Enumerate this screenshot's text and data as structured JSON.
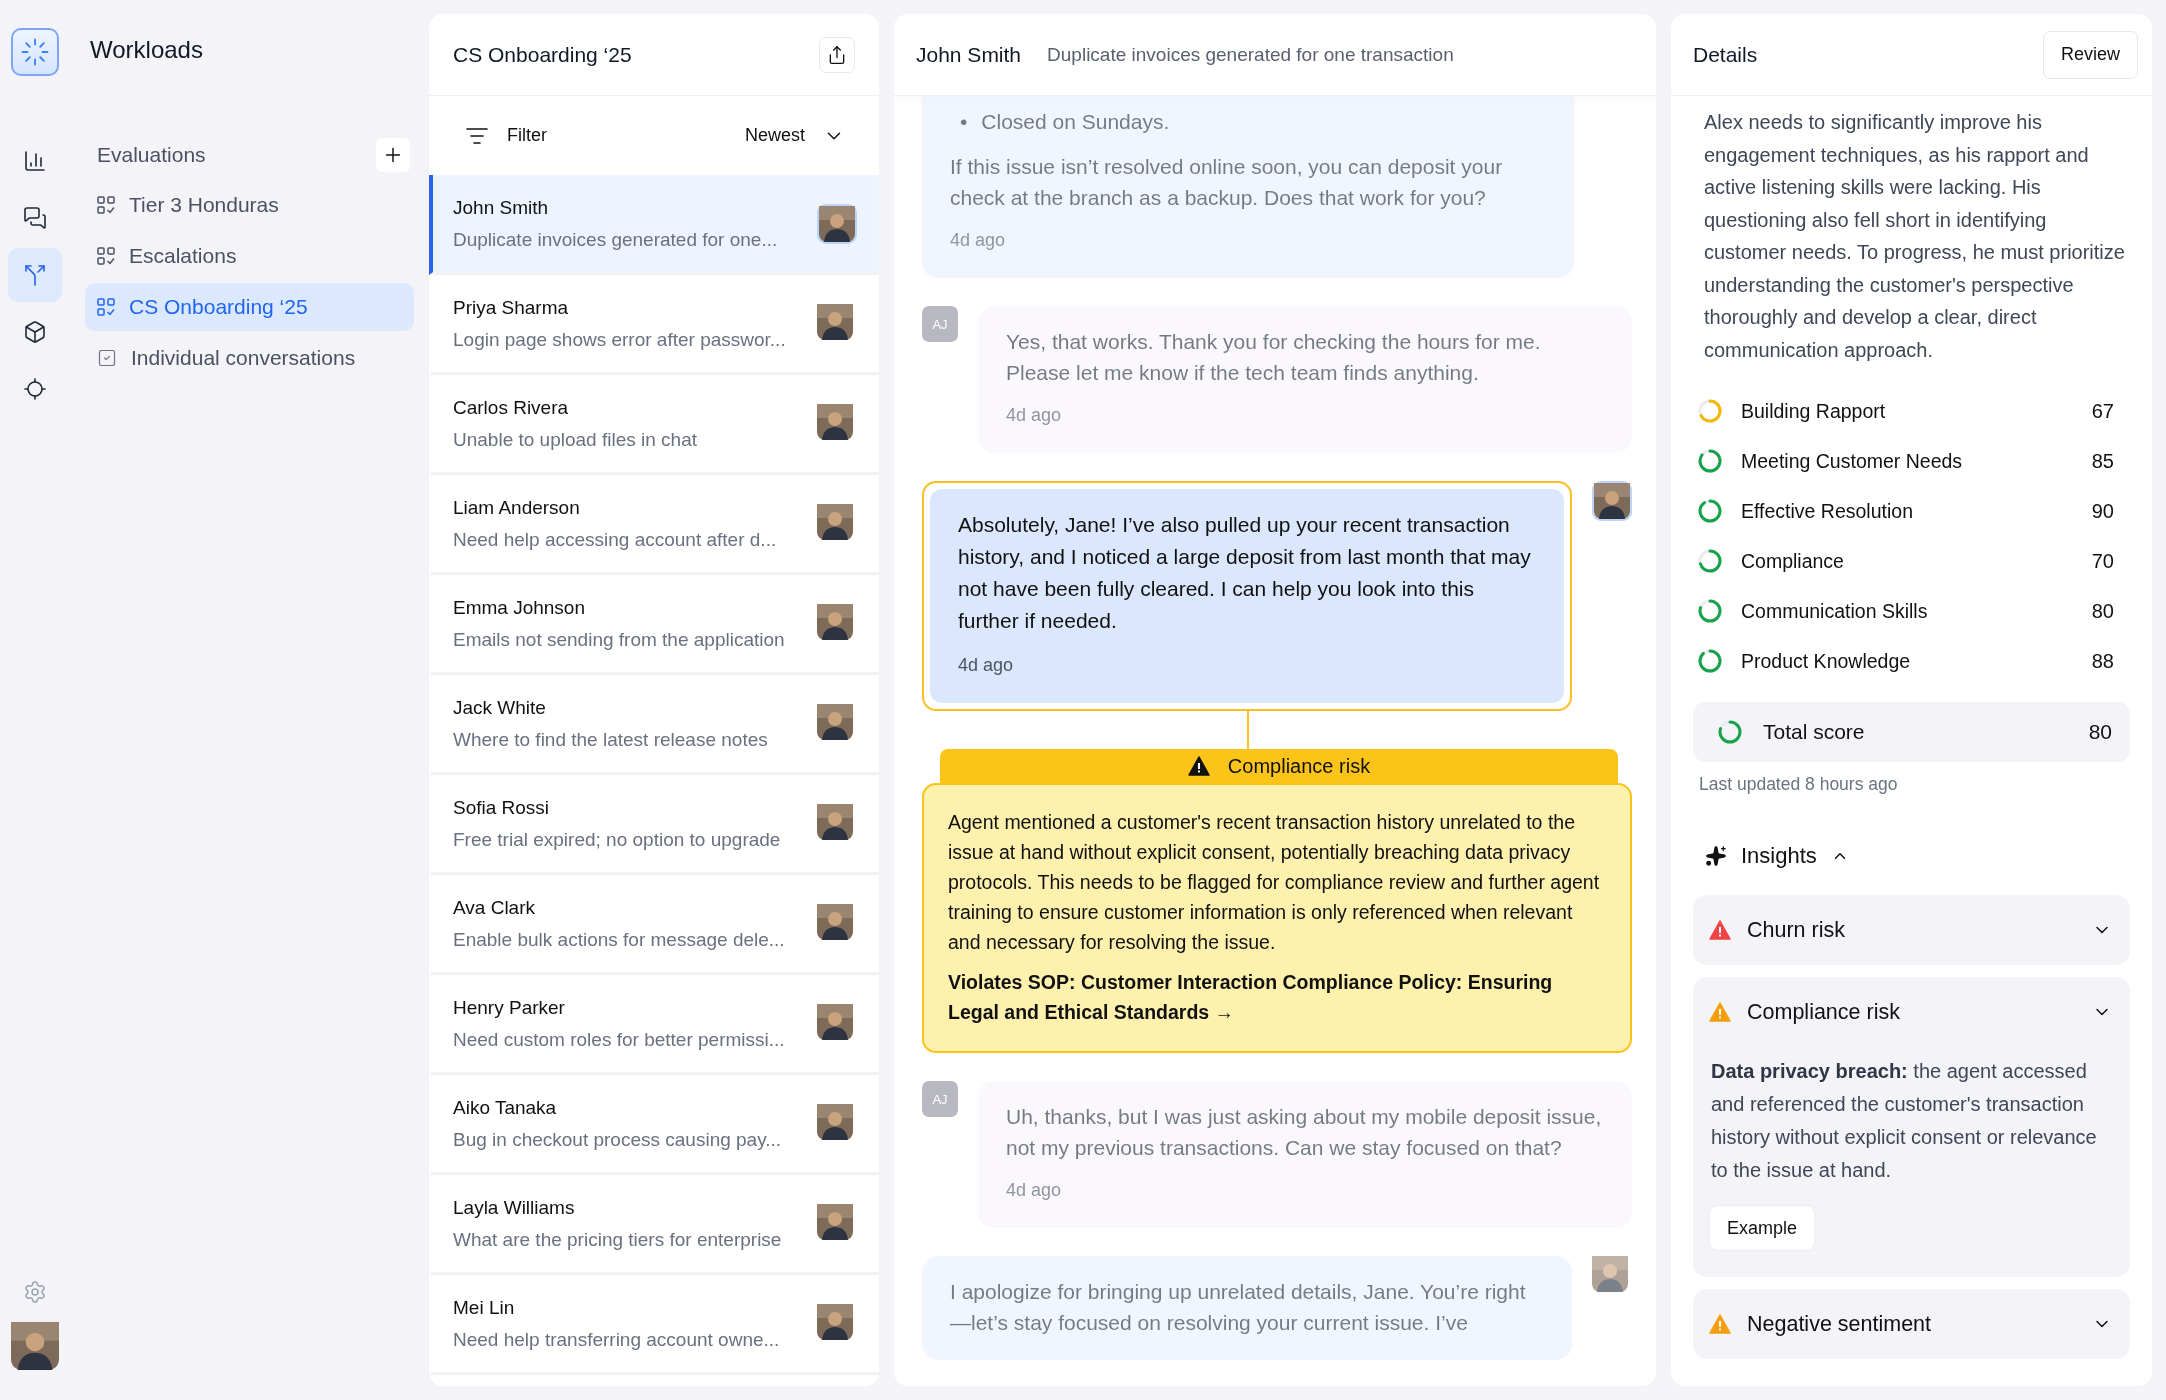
{
  "rail": {
    "items": [
      {
        "kind": "chart",
        "selected": false
      },
      {
        "kind": "chat",
        "selected": false
      },
      {
        "kind": "flow",
        "selected": true
      },
      {
        "kind": "cube",
        "selected": false
      },
      {
        "kind": "focus",
        "selected": false
      }
    ]
  },
  "nav": {
    "title": "Workloads",
    "section": "Evaluations",
    "items": [
      {
        "label": "Tier 3 Honduras",
        "kind": "evaluation",
        "selected": false
      },
      {
        "label": "Escalations",
        "kind": "evaluation",
        "selected": false
      },
      {
        "label": "CS Onboarding ‘25",
        "kind": "evaluation",
        "selected": true
      },
      {
        "label": "Individual conversations",
        "kind": "conversations",
        "selected": false
      }
    ]
  },
  "conversations": {
    "title": "CS Onboarding ‘25",
    "filter": "Filter",
    "sort": "Newest",
    "items": [
      {
        "name": "John Smith",
        "preview": "Duplicate invoices generated for one...",
        "selected": true
      },
      {
        "name": "Priya Sharma",
        "preview": "Login page shows error after passwor...",
        "selected": false
      },
      {
        "name": "Carlos Rivera",
        "preview": "Unable to upload files in chat",
        "selected": false
      },
      {
        "name": "Liam Anderson",
        "preview": "Need help accessing account after d...",
        "selected": false
      },
      {
        "name": "Emma Johnson",
        "preview": "Emails not sending from the application",
        "selected": false
      },
      {
        "name": "Jack White",
        "preview": "Where to find the latest release notes",
        "selected": false
      },
      {
        "name": "Sofia Rossi",
        "preview": "Free trial expired; no option to upgrade",
        "selected": false
      },
      {
        "name": "Ava Clark",
        "preview": "Enable bulk actions for message dele...",
        "selected": false
      },
      {
        "name": "Henry Parker",
        "preview": "Need custom roles for better permissi...",
        "selected": false
      },
      {
        "name": "Aiko Tanaka",
        "preview": "Bug in checkout process causing pay...",
        "selected": false
      },
      {
        "name": "Layla Williams",
        "preview": "What are the pricing tiers for enterprise",
        "selected": false
      },
      {
        "name": "Mei Lin",
        "preview": "Need help transferring account owne...",
        "selected": false
      }
    ]
  },
  "chat": {
    "name": "John Smith",
    "subject": "Duplicate invoices generated for one transaction",
    "messages": [
      {
        "kind": "agent",
        "dimmed": true,
        "avatar": false,
        "bullets": [
          {
            "marker": "•",
            "text": "Closed on Sundays."
          }
        ],
        "text": "If this issue isn’t resolved online soon, you can deposit your check at the branch as a backup. Does that work for you?",
        "time": "4d ago"
      },
      {
        "kind": "customer",
        "initials": "AJ",
        "dimmed": true,
        "text": "Yes, that works. Thank you for checking the hours for me. Please let me know if the tech team finds anything.",
        "time": "4d ago"
      },
      {
        "kind": "agent",
        "dimmed": false,
        "avatar": true,
        "text": "Absolutely, Jane! I’ve also pulled up your recent transaction history, and I noticed a large deposit from last month that may not have been fully cleared. I can help you look into this further if needed.",
        "time": "4d ago",
        "flag": {
          "title": "Compliance risk",
          "text": "Agent mentioned a customer's recent transaction history unrelated to the issue at hand without explicit consent, potentially breaching data privacy protocols. This needs to be flagged for compliance review and further agent training to ensure customer information is only referenced when relevant and necessary for resolving the issue.",
          "sop": "Violates SOP: Customer Interaction Compliance Policy: Ensuring Legal and Ethical Standards →"
        }
      },
      {
        "kind": "customer",
        "initials": "AJ",
        "dimmed": true,
        "text": "Uh, thanks, but I was just asking about my mobile deposit issue, not my previous transactions. Can we stay focused on that?",
        "time": "4d ago"
      },
      {
        "kind": "agent",
        "dimmed": true,
        "avatar": true,
        "text": "I apologize for bringing up unrelated details, Jane. You’re right—let’s stay focused on resolving your current issue. I’ve"
      }
    ]
  },
  "details": {
    "title": "Details",
    "review": "Review",
    "summary": "Alex needs to significantly improve his engagement techniques, as his rapport and active listening skills were lacking. His questioning also fell short in identifying customer needs. To progress, he must prioritize understanding the customer's perspective thoroughly and develop a clear, direct communication approach.",
    "scores": [
      {
        "label": "Building Rapport",
        "score": "67",
        "color": "#f5b800"
      },
      {
        "label": "Meeting Customer Needs",
        "score": "85",
        "color": "#16a34a"
      },
      {
        "label": "Effective Resolution",
        "score": "90",
        "color": "#16a34a"
      },
      {
        "label": "Compliance",
        "score": "70",
        "color": "#16a34a"
      },
      {
        "label": "Communication Skills",
        "score": "80",
        "color": "#16a34a"
      },
      {
        "label": "Product Knowledge",
        "score": "88",
        "color": "#16a34a"
      }
    ],
    "total": {
      "label": "Total score",
      "score": "80",
      "color": "#16a34a"
    },
    "updated": "Last updated 8 hours ago",
    "insights": {
      "title": "Insights",
      "expanded": true,
      "items": [
        {
          "title": "Churn risk",
          "color": "#ef4444"
        },
        {
          "title": "Compliance risk",
          "color": "#f59e0b",
          "text": "**Data privacy breach:** the agent accessed and referenced the customer's transaction history without explicit consent or relevance to the issue at hand.",
          "action": "Example"
        },
        {
          "title": "Negative sentiment",
          "color": "#f59e0b"
        }
      ]
    }
  }
}
